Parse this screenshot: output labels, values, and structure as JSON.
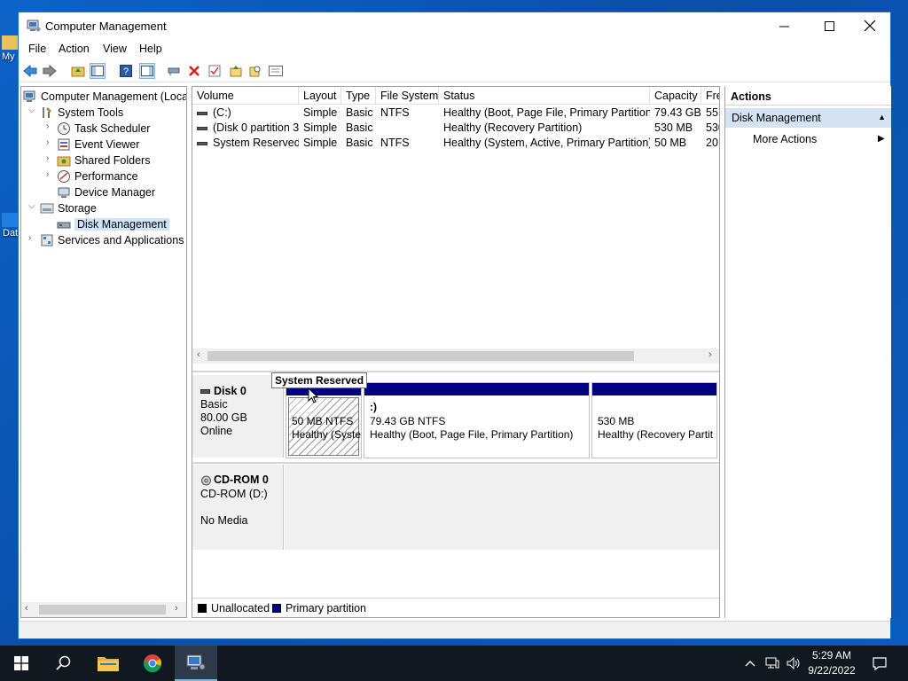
{
  "window": {
    "title": "Computer Management",
    "controls": {
      "minimize": "—",
      "maximize": "☐",
      "close": "✕"
    }
  },
  "menu": [
    "File",
    "Action",
    "View",
    "Help"
  ],
  "toolbar_icons": [
    "back-arrow-icon",
    "forward-arrow-icon",
    "up-folder-icon",
    "show-hide-console-tree-icon",
    "help-icon",
    "action-pane-icon",
    "connect-icon",
    "delete-icon",
    "properties-icon",
    "export-icon",
    "search-icon",
    "view-icon"
  ],
  "tree": {
    "root": "Computer Management (Local",
    "items": [
      {
        "label": "System Tools",
        "level": 1,
        "expanded": true,
        "icon": "tools-icon"
      },
      {
        "label": "Task Scheduler",
        "level": 2,
        "icon": "clock-icon"
      },
      {
        "label": "Event Viewer",
        "level": 2,
        "icon": "event-viewer-icon"
      },
      {
        "label": "Shared Folders",
        "level": 2,
        "icon": "shared-folder-icon"
      },
      {
        "label": "Performance",
        "level": 2,
        "icon": "performance-icon"
      },
      {
        "label": "Device Manager",
        "level": 2,
        "icon": "device-manager-icon"
      },
      {
        "label": "Storage",
        "level": 1,
        "expanded": true,
        "icon": "storage-icon"
      },
      {
        "label": "Disk Management",
        "level": 2,
        "selected": true,
        "icon": "disk-icon"
      },
      {
        "label": "Services and Applications",
        "level": 1,
        "icon": "services-icon"
      }
    ]
  },
  "volumes": {
    "columns": [
      "Volume",
      "Layout",
      "Type",
      "File System",
      "Status",
      "Capacity",
      "Fre"
    ],
    "rows": [
      [
        "(C:)",
        "Simple",
        "Basic",
        "NTFS",
        "Healthy (Boot, Page File, Primary Partition)",
        "79.43 GB",
        "55."
      ],
      [
        "(Disk 0 partition 3)",
        "Simple",
        "Basic",
        "",
        "Healthy (Recovery Partition)",
        "530 MB",
        "530"
      ],
      [
        "System Reserved",
        "Simple",
        "Basic",
        "NTFS",
        "Healthy (System, Active, Primary Partition)",
        "50 MB",
        "20"
      ]
    ]
  },
  "disks": {
    "disk0": {
      "name": "Disk 0",
      "type": "Basic",
      "size": "80.00 GB",
      "state": "Online",
      "partitions": [
        {
          "size": "50 MB NTFS",
          "status": "Healthy (Syste"
        },
        {
          "name": ":)",
          "size": "79.43 GB NTFS",
          "status": "Healthy (Boot, Page File, Primary Partition)"
        },
        {
          "size": "530 MB",
          "status": "Healthy (Recovery Partit"
        }
      ]
    },
    "cdrom0": {
      "name": "CD-ROM 0",
      "drive": "CD-ROM (D:)",
      "media": "No Media"
    }
  },
  "tooltip": "System Reserved",
  "legend": [
    {
      "label": "Unallocated",
      "color": "#000000"
    },
    {
      "label": "Primary partition",
      "color": "#000080"
    }
  ],
  "actions": {
    "title": "Actions",
    "section": "Disk Management",
    "item": "More Actions"
  },
  "desktop_labels": [
    "My",
    "Dat"
  ],
  "taskbar": {
    "time": "5:29 AM",
    "date": "9/22/2022"
  }
}
